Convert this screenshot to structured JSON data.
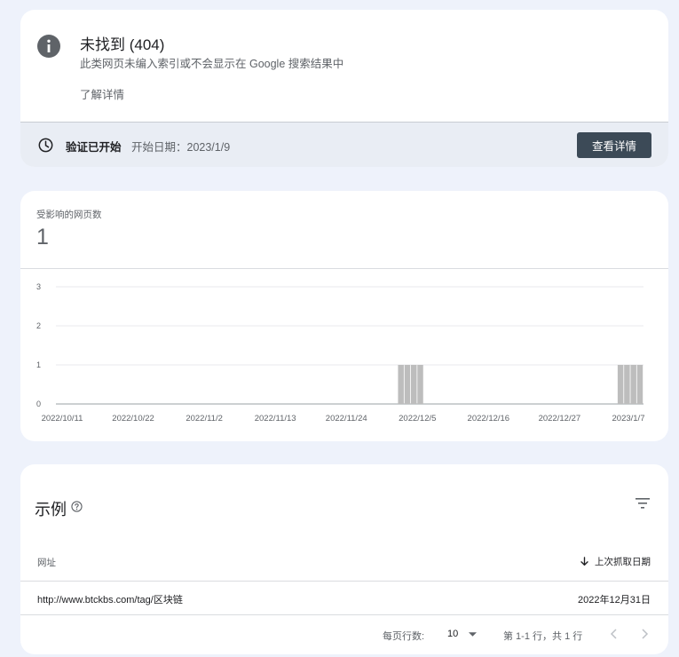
{
  "issue": {
    "title": "未找到 (404)",
    "description": "此类网页未编入索引或不会显示在 Google 搜索结果中",
    "learn_more": "了解详情",
    "icon": "info-icon"
  },
  "validation": {
    "status": "验证已开始",
    "start_date": "开始日期：2023/1/9",
    "button_label": "查看详情",
    "icon": "clock-icon"
  },
  "summary": {
    "affected_label": "受影响的网页数",
    "affected_value": "1"
  },
  "chart_data": {
    "type": "bar",
    "ylim": [
      0,
      3
    ],
    "yticks": [
      "0",
      "1",
      "2",
      "3"
    ],
    "xticks": [
      "2022/10/11",
      "2022/10/22",
      "2022/11/2",
      "2022/11/13",
      "2022/11/24",
      "2022/12/5",
      "2022/12/16",
      "2022/12/27",
      "2023/1/7"
    ],
    "start_date": "2022/10/11",
    "end_date": "2023/1/9",
    "bars": [
      {
        "date": "2022/12/2",
        "value": 1
      },
      {
        "date": "2022/12/3",
        "value": 1
      },
      {
        "date": "2022/12/4",
        "value": 1
      },
      {
        "date": "2022/12/5",
        "value": 1
      },
      {
        "date": "2023/1/5",
        "value": 1
      },
      {
        "date": "2023/1/6",
        "value": 1
      },
      {
        "date": "2023/1/7",
        "value": 1
      },
      {
        "date": "2023/1/8",
        "value": 1
      }
    ],
    "bar_color": "#bdbdbd",
    "grid": true
  },
  "examples": {
    "title": "示例",
    "columns": {
      "url": "网址",
      "date": "上次抓取日期"
    },
    "rows": [
      {
        "url": "http://www.btckbs.com/tag/区块链",
        "date": "2022年12月31日"
      }
    ],
    "footer": {
      "rows_per_page_label": "每页行数:",
      "rows_per_page_value": "10",
      "page_info": "第 1-1 行，共 1 行"
    }
  }
}
